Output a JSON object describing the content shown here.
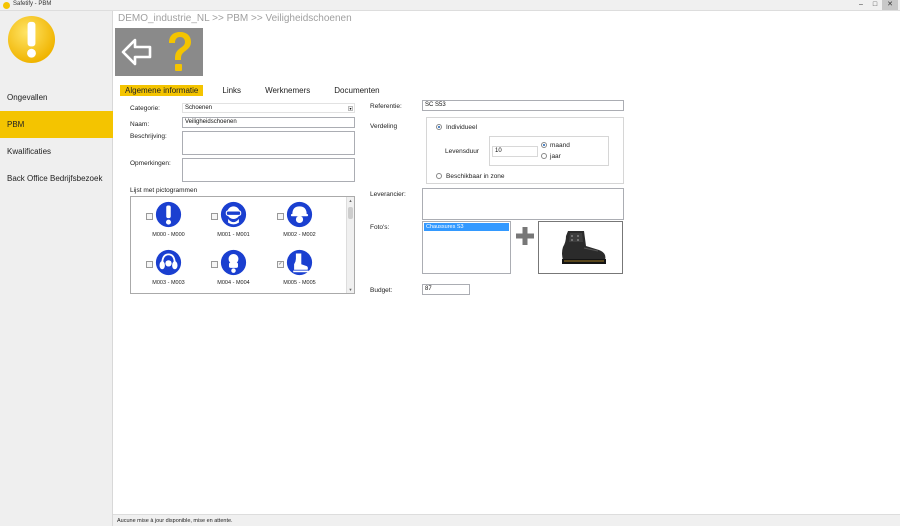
{
  "window": {
    "title": "Safetify - PBM",
    "minimize": "–",
    "maximize": "□",
    "close": "✕"
  },
  "sidebar": {
    "logo_icon": "exclamation-icon",
    "items": [
      {
        "label": "Ongevallen",
        "active": false
      },
      {
        "label": "PBM",
        "active": true
      },
      {
        "label": "Kwalificaties",
        "active": false
      },
      {
        "label": "Back Office Bedrijfsbezoek",
        "active": false
      }
    ]
  },
  "breadcrumb": "DEMO_industrie_NL >> PBM >> Veiligheidschoenen",
  "toolbar": {
    "back_icon": "arrow-left-icon",
    "help_icon": "question-icon"
  },
  "tabs": [
    {
      "label": "Algemene informatie",
      "active": true
    },
    {
      "label": "Links",
      "active": false
    },
    {
      "label": "Werknemers",
      "active": false
    },
    {
      "label": "Documenten",
      "active": false
    }
  ],
  "form": {
    "categorie_label": "Categorie:",
    "categorie_value": "Schoenen",
    "naam_label": "Naam:",
    "naam_value": "Veiligheidschoenen",
    "beschrijving_label": "Beschrijving:",
    "beschrijving_value": "",
    "opmerkingen_label": "Opmerkingen:",
    "opmerkingen_value": "",
    "picto_label": "Lijst met pictogrammen",
    "referentie_label": "Referentie:",
    "referentie_value": "SC S53",
    "verdeling_label": "Verdeling",
    "individueel_label": "Individueel",
    "levensduur_label": "Levensduur",
    "levensduur_value": "10",
    "maand_label": "maand",
    "jaar_label": "jaar",
    "zone_label": "Beschikbaar in zone",
    "leverancier_label": "Leverancier:",
    "leverancier_value": "",
    "fotos_label": "Foto's:",
    "foto_items": [
      "Chaussures S3"
    ],
    "add_photo_icon": "plus-icon",
    "photo_icon": "safety-boot-icon",
    "budget_label": "Budget:",
    "budget_value": "87"
  },
  "pictograms": [
    {
      "code": "M000 - M000",
      "icon": "exclamation-icon",
      "checked": false
    },
    {
      "code": "M001 - M001",
      "icon": "safety-goggles-icon",
      "checked": false
    },
    {
      "code": "M002 - M002",
      "icon": "hard-hat-icon",
      "checked": false
    },
    {
      "code": "M003 - M003",
      "icon": "ear-protection-icon",
      "checked": false
    },
    {
      "code": "M004 - M004",
      "icon": "respirator-icon",
      "checked": false
    },
    {
      "code": "M005 - M005",
      "icon": "safety-boot-icon",
      "checked": true
    }
  ],
  "status": "Aucune mise à jour disponible, mise en attente.",
  "colors": {
    "accent": "#f4c400",
    "sign_blue": "#1a3fd0",
    "toolbar": "#8a8a8a",
    "selection": "#3399ff"
  }
}
